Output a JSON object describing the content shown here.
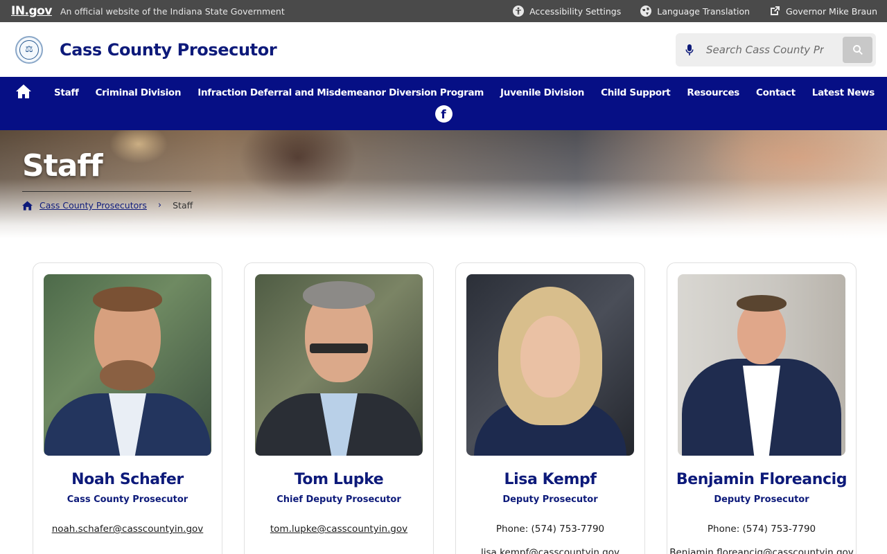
{
  "topbar": {
    "logo": "IN.gov",
    "official": "An official website of the Indiana State Government",
    "accessibility": "Accessibility Settings",
    "language": "Language Translation",
    "governor": "Governor Mike Braun"
  },
  "header": {
    "title": "Cass County Prosecutor",
    "search_placeholder": "Search Cass County Prosecutor"
  },
  "nav": {
    "items": [
      "Staff",
      "Criminal Division",
      "Infraction Deferral and Misdemeanor Diversion Program",
      "Juvenile Division",
      "Child Support",
      "Resources",
      "Contact",
      "Latest News"
    ]
  },
  "hero": {
    "title": "Staff",
    "breadcrumb_home": "Cass County Prosecutors",
    "breadcrumb_current": "Staff"
  },
  "staff": [
    {
      "name": "Noah Schafer",
      "role": "Cass County Prosecutor",
      "phone": "",
      "email": "noah.schafer@casscountyin.gov"
    },
    {
      "name": "Tom Lupke",
      "role": "Chief Deputy Prosecutor",
      "phone": "",
      "email": "tom.lupke@casscountyin.gov"
    },
    {
      "name": "Lisa Kempf",
      "role": "Deputy Prosecutor",
      "phone": "Phone: (574) 753-7790",
      "email": "lisa.kempf@casscountyin.gov"
    },
    {
      "name": "Benjamin Floreancig",
      "role": "Deputy Prosecutor",
      "phone": "Phone: (574) 753-7790",
      "email": "Benjamin.floreancig@casscountyin.gov"
    }
  ],
  "colors": {
    "brand_navy": "#060f85",
    "topbar": "#4a4a4a",
    "title_navy": "#0d1a7a"
  }
}
